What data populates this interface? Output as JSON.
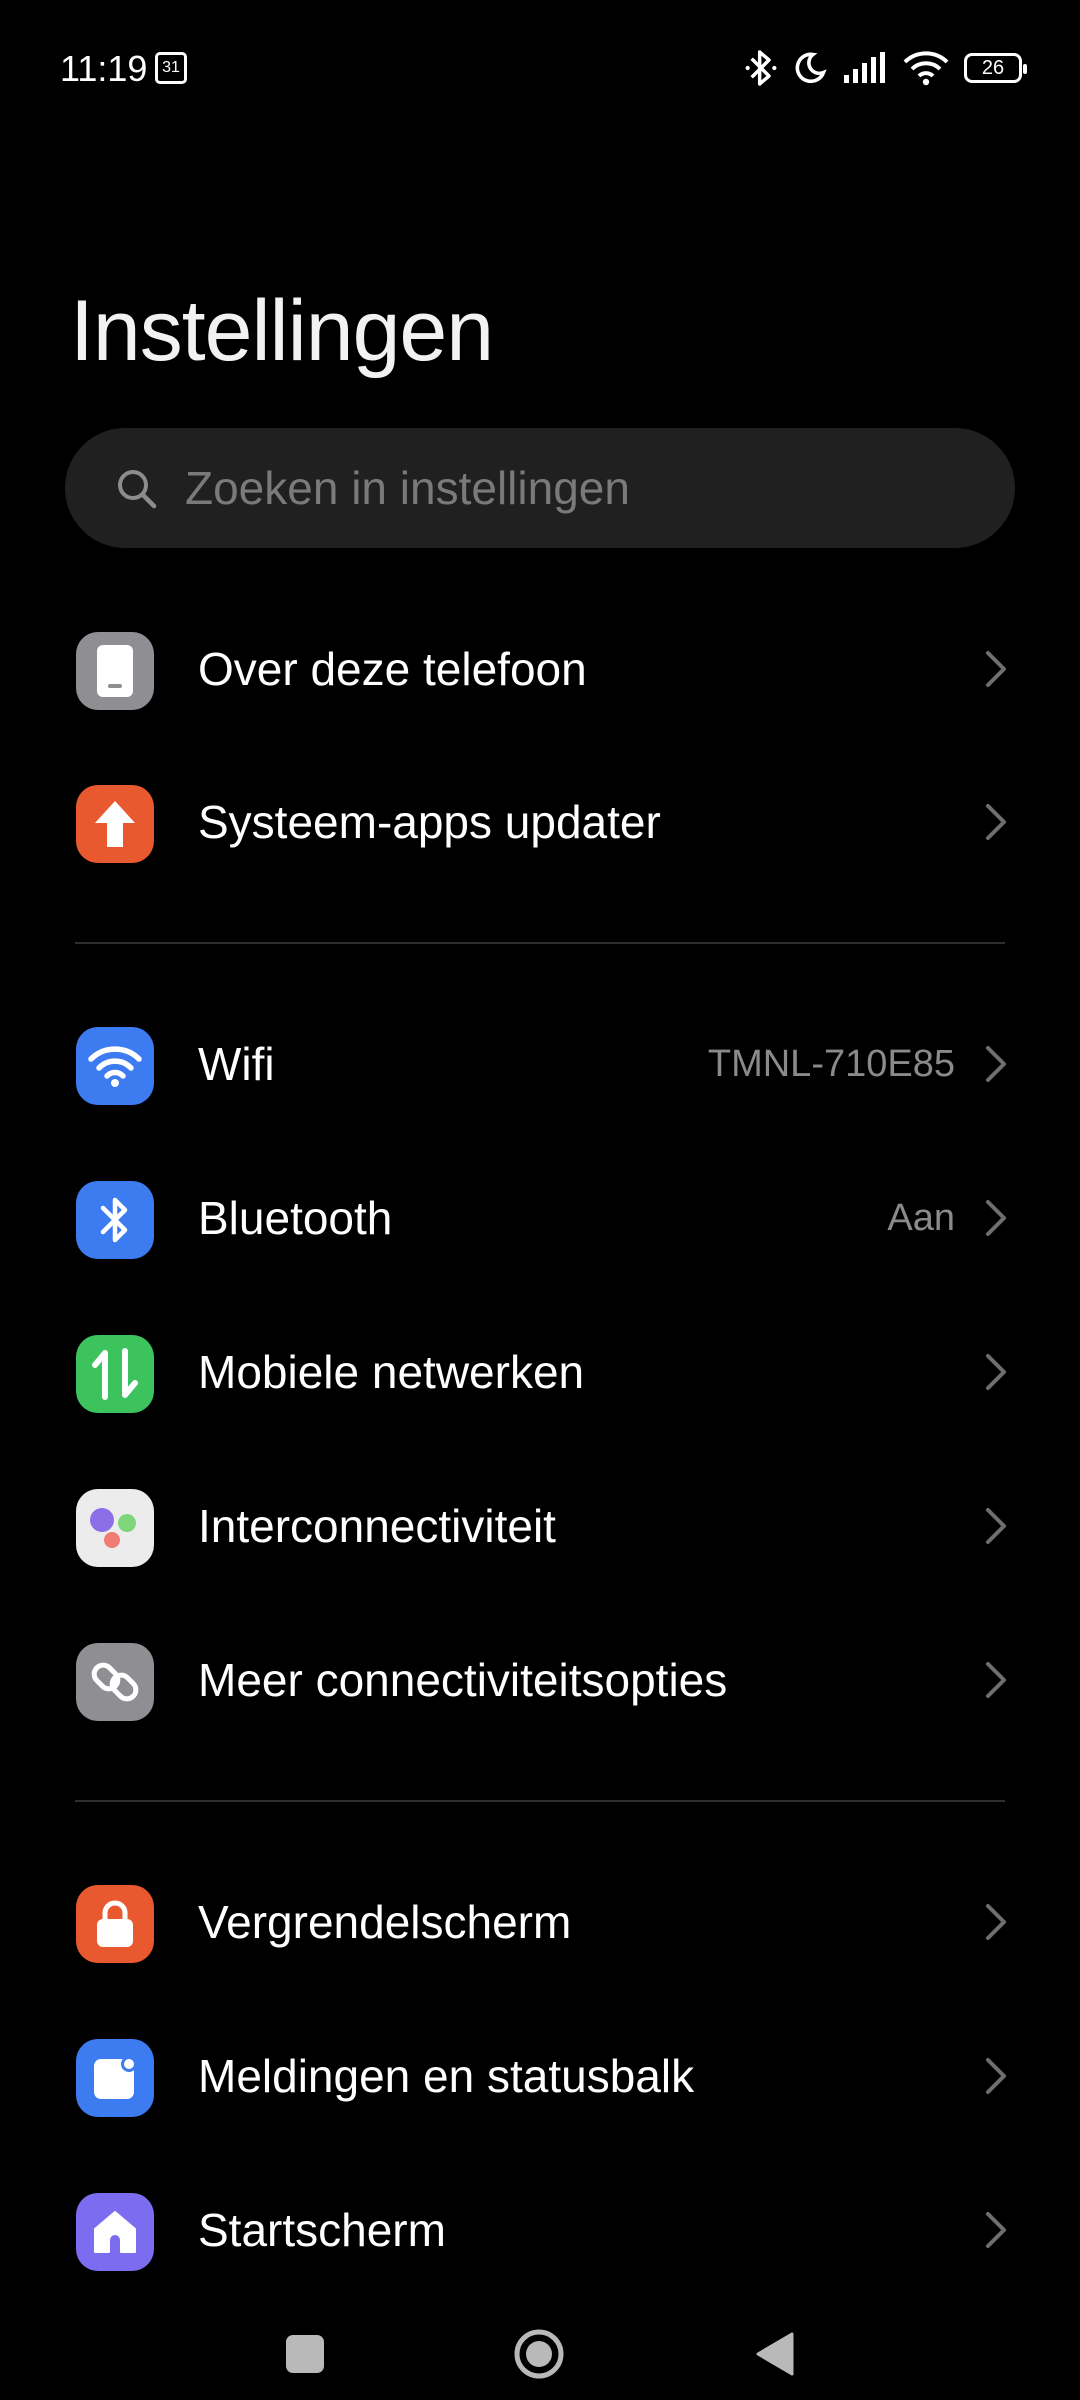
{
  "status_bar": {
    "time": "11:19",
    "calendar_date": "31",
    "battery": "26"
  },
  "title": "Instellingen",
  "search": {
    "placeholder": "Zoeken in instellingen"
  },
  "items": [
    {
      "label": "Over deze telefoon",
      "value": "",
      "icon": "phone-icon",
      "color": "#8e8e93"
    },
    {
      "label": "Systeem-apps updater",
      "value": "",
      "icon": "arrow-up-icon",
      "color": "#e9592f"
    },
    {
      "label": "Wifi",
      "value": "TMNL-710E85",
      "icon": "wifi-icon",
      "color": "#3d7bf0"
    },
    {
      "label": "Bluetooth",
      "value": "Aan",
      "icon": "bluetooth-icon",
      "color": "#3d7bf0"
    },
    {
      "label": "Mobiele netwerken",
      "value": "",
      "icon": "mobile-data-icon",
      "color": "#3dc35d"
    },
    {
      "label": "Interconnectiviteit",
      "value": "",
      "icon": "interconnect-icon",
      "color": "#ececec"
    },
    {
      "label": "Meer connectiviteitsopties",
      "value": "",
      "icon": "link-icon",
      "color": "#8e8e93"
    },
    {
      "label": "Vergrendelscherm",
      "value": "",
      "icon": "lock-icon",
      "color": "#e9592f"
    },
    {
      "label": "Meldingen en statusbalk",
      "value": "",
      "icon": "notification-icon",
      "color": "#3d7bf0"
    },
    {
      "label": "Startscherm",
      "value": "",
      "icon": "home-icon",
      "color": "#7b6cf0"
    }
  ]
}
